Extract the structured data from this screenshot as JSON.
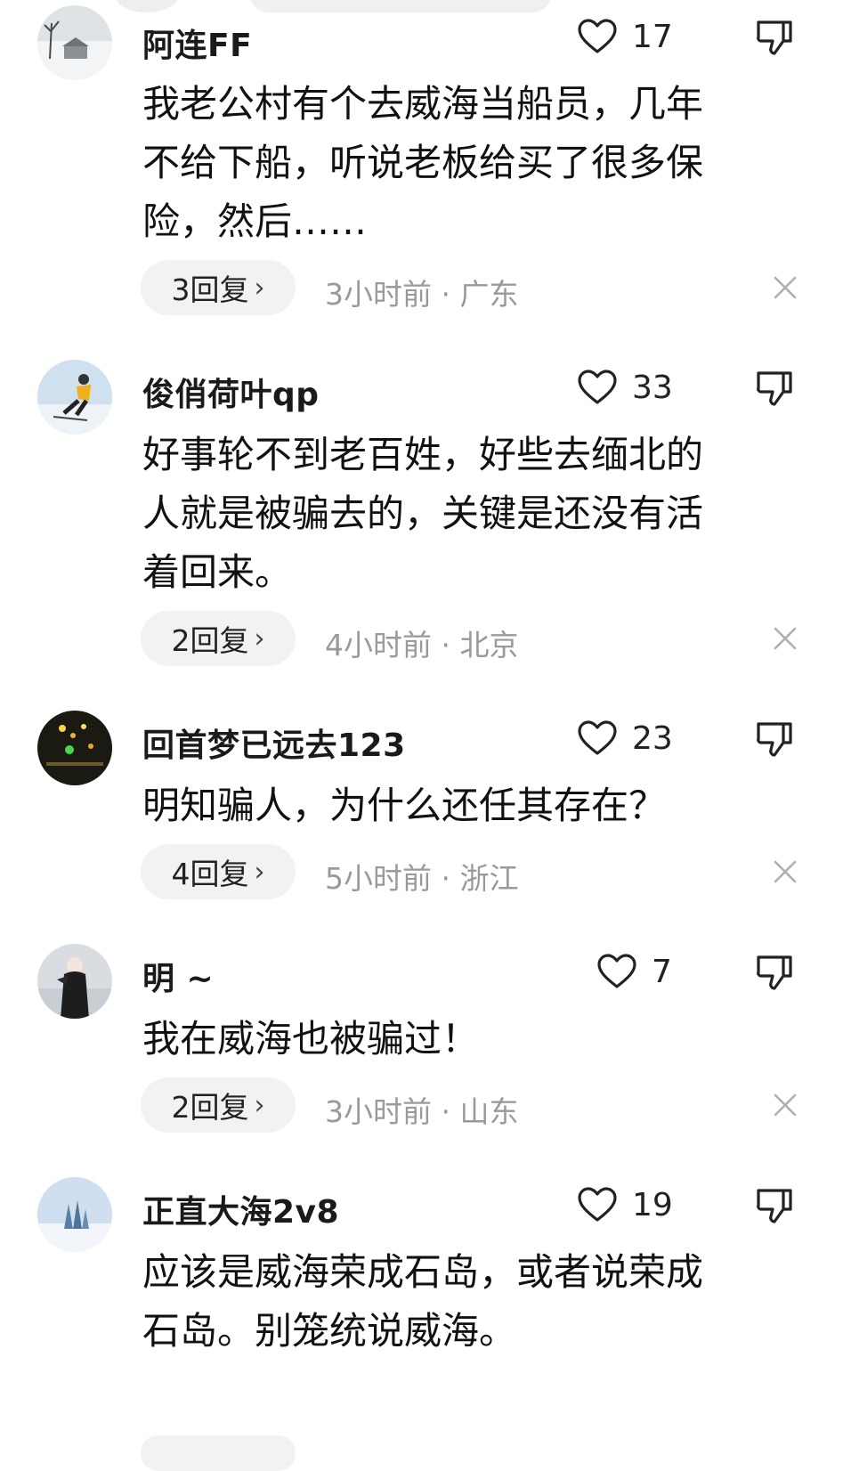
{
  "comments": [
    {
      "username": "阿连FF",
      "likes": "17",
      "lines": [
        "我老公村有个去威海当船员，几年",
        "不给下船，听说老板给买了很多保",
        "险，然后……"
      ],
      "replies": "3回复",
      "meta": "3小时前 · 广东",
      "avatar": "snow-village-avatar"
    },
    {
      "username": "俊俏荷叶qp",
      "likes": "33",
      "lines": [
        "好事轮不到老百姓，好些去缅北的",
        "人就是被骗去的，关键是还没有活",
        "着回来。"
      ],
      "replies": "2回复",
      "meta": "4小时前 · 北京",
      "avatar": "skier-avatar"
    },
    {
      "username": "回首梦已远去123",
      "likes": "23",
      "lines": [
        "明知骗人，为什么还任其存在？"
      ],
      "replies": "4回复",
      "meta": "5小时前 · 浙江",
      "avatar": "night-lights-avatar"
    },
    {
      "username": "明 ~",
      "likes": "7",
      "lines": [
        "我在威海也被骗过！"
      ],
      "replies": "2回复",
      "meta": "3小时前 · 山东",
      "avatar": "person-photo-avatar"
    },
    {
      "username": "正直大海2v8",
      "likes": "19",
      "lines": [
        "应该是威海荣成石岛，或者说荣成",
        "石岛。别笼统说威海。"
      ],
      "replies": "",
      "meta": "",
      "avatar": "snow-trees-avatar"
    }
  ],
  "icons": {
    "like": "heart-outline-icon",
    "dislike": "thumbs-down-icon",
    "close": "close-x-icon",
    "reply_chevron": "›"
  }
}
